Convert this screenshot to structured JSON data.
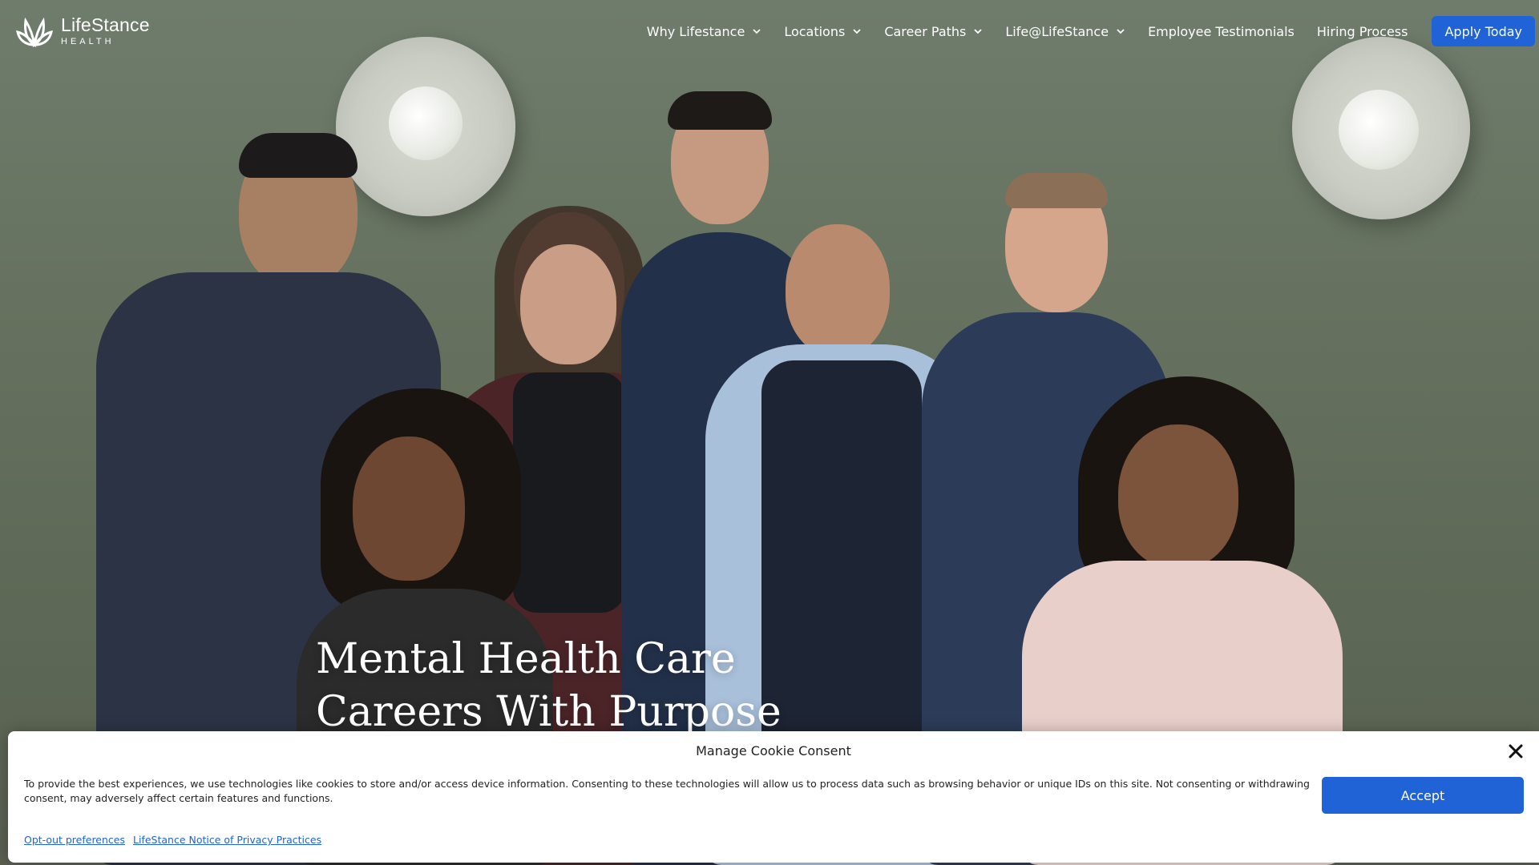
{
  "brand": {
    "name": "LifeStance",
    "sub": "HEALTH",
    "logo_icon": "lotus-logo-icon"
  },
  "nav": {
    "items": [
      {
        "label": "Why Lifestance",
        "has_dropdown": true
      },
      {
        "label": "Locations",
        "has_dropdown": true
      },
      {
        "label": "Career Paths",
        "has_dropdown": true
      },
      {
        "label": "Life@LifeStance",
        "has_dropdown": true
      },
      {
        "label": "Employee Testimonials",
        "has_dropdown": false
      },
      {
        "label": "Hiring Process",
        "has_dropdown": false
      }
    ],
    "apply_label": "Apply Today"
  },
  "hero": {
    "headline_line1": "Mental Health Care",
    "headline_line2": "Careers With Purpose"
  },
  "cookie": {
    "title": "Manage Cookie Consent",
    "text": "To provide the best experiences, we use technologies like cookies to store and/or access device information. Consenting to these technologies will allow us to process data such as browsing behavior or unique IDs on this site. Not consenting or withdrawing consent, may adversely affect certain features and functions.",
    "accept_label": "Accept",
    "link_optout": "Opt-out preferences",
    "link_privacy": "LifeStance Notice of Privacy Practices"
  },
  "colors": {
    "accent": "#1f63d6",
    "wall": "#66725f",
    "text_light": "#ffffff"
  }
}
